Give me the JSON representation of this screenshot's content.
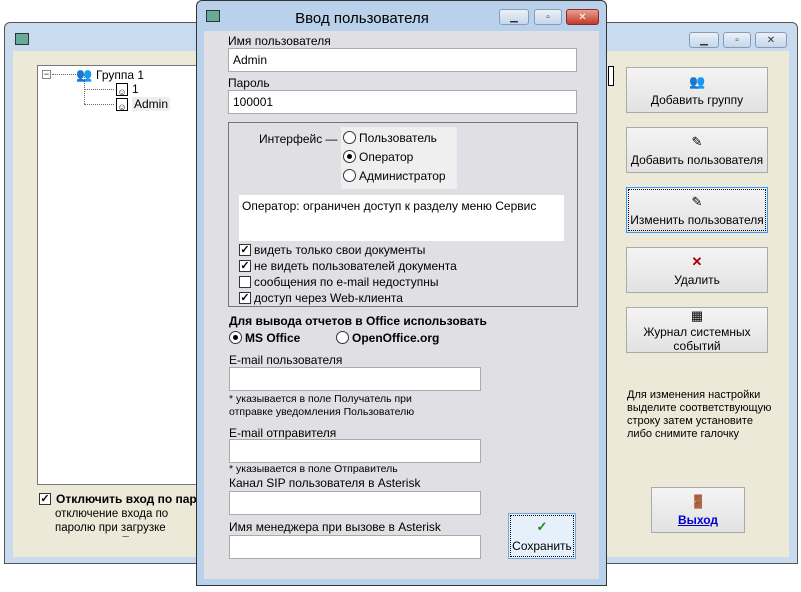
{
  "main_window": {
    "tree": {
      "group": "Группа 1",
      "users": [
        "1",
        "Admin"
      ]
    },
    "buttons": {
      "add_group": "Добавить группу",
      "add_user": "Добавить пользователя",
      "edit_user": "Изменить пользователя",
      "delete": "Удалить",
      "log": "Журнал системных событий",
      "exit": "Выход"
    },
    "hint": "Для изменения настройки выделите соответствующую строку затем установите либо снимите галочку",
    "disable_login_label": "Отключить вход по паро",
    "disable_login_desc": "отключение входа по паролю при загрузке программы. Полны"
  },
  "dialog": {
    "title": "Ввод пользователя",
    "username_label": "Имя пользователя",
    "username": "Admin",
    "password_label": "Пароль",
    "password": "100001",
    "interface_label": "Интерфейс —",
    "interface_options": [
      "Пользователь",
      "Оператор",
      "Администратор"
    ],
    "interface_selected": "Оператор",
    "description": "Оператор: ограничен доступ к разделу меню Сервис",
    "options": [
      {
        "label": "видеть только свои документы",
        "checked": true
      },
      {
        "label": "не видеть пользователей документа",
        "checked": true
      },
      {
        "label": "сообщения по e-mail недоступны",
        "checked": false
      },
      {
        "label": "доступ через Web-клиента",
        "checked": true
      }
    ],
    "office_label": "Для вывода отчетов в Office использовать",
    "office_options": [
      "MS Office",
      "OpenOffice.org"
    ],
    "office_selected": "MS Office",
    "email_user_label": "E-mail пользователя",
    "email_user": "",
    "email_user_note": "* указывается в поле Получатель при отправке уведомления Пользователю",
    "email_sender_label": "E-mail отправителя",
    "email_sender": "",
    "email_sender_note": "* указывается в поле Отправитель",
    "sip_label": "Канал SIP пользователя в Asterisk",
    "sip": "",
    "manager_label": "Имя менеджера при вызове в Asterisk",
    "manager": "",
    "save": "Сохранить"
  }
}
